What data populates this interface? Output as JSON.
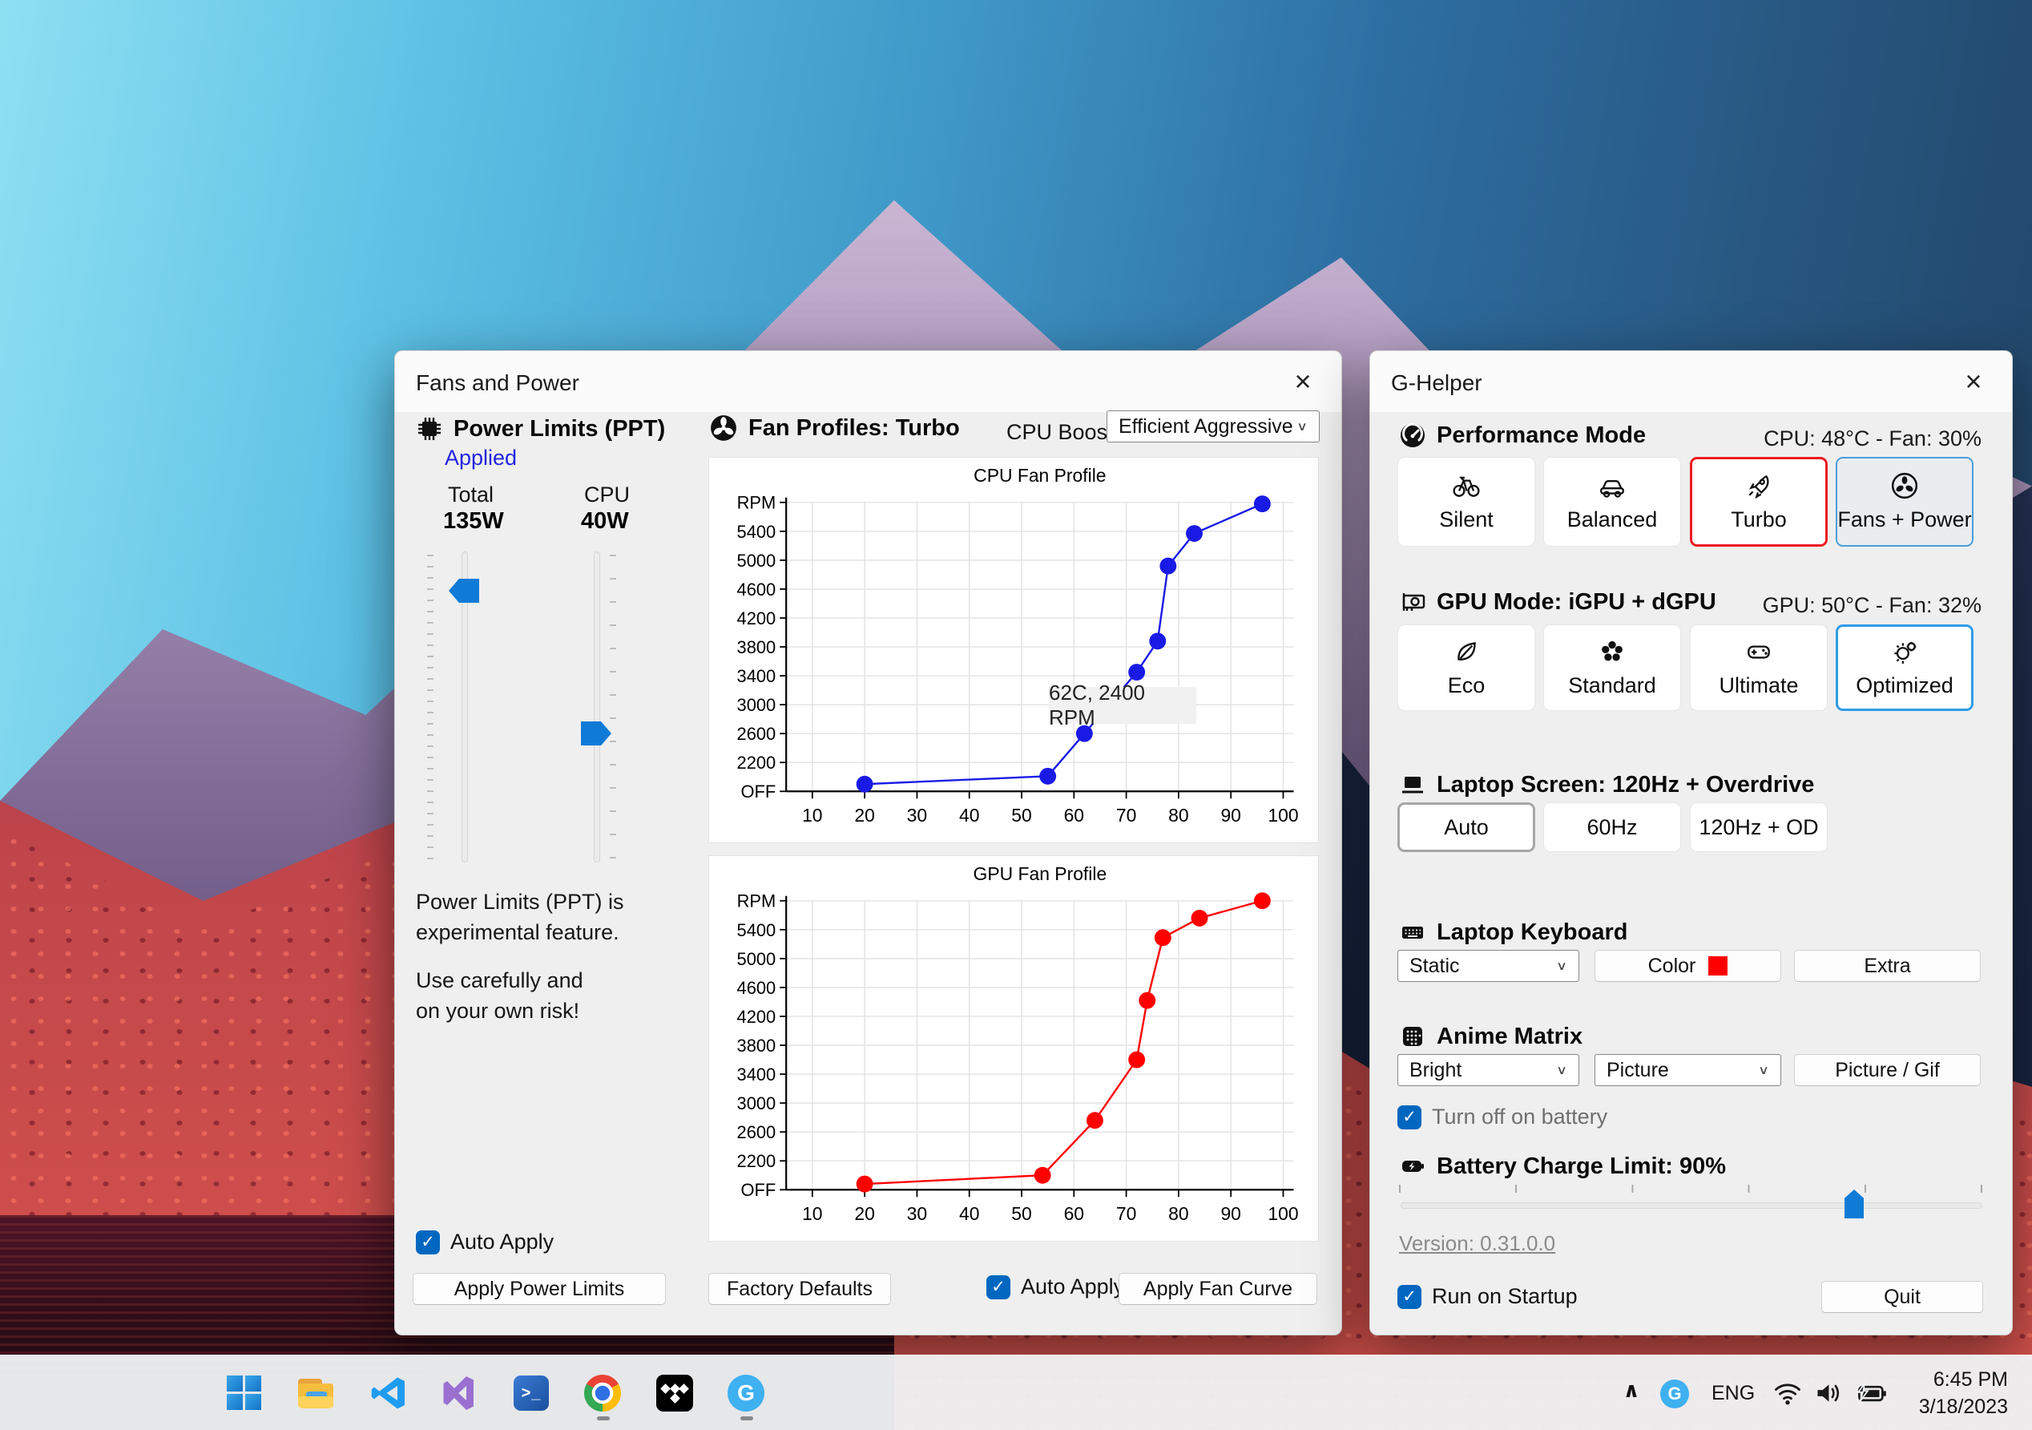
{
  "icons": {
    "close": "×",
    "chevron_down": "∨",
    "chevron_up": "∧",
    "check": "✓",
    "prompt": ">_",
    "g_logo": "G"
  },
  "colors": {
    "accent_blue": "#0f7bd7",
    "checkbox_blue": "#0067c0",
    "turbo_selected_border": "#ed1b24",
    "optimized_selected_border": "#2f9ce8",
    "cpu_series": "#1a1ae6",
    "gpu_series": "#ff0000",
    "keyboard_color_swatch": "#ff0000",
    "applied_text": "#2323e0"
  },
  "fans_window": {
    "title": "Fans and Power",
    "power_limits": {
      "header": "Power Limits (PPT)",
      "status": "Applied",
      "total_label": "Total",
      "total_value": "135W",
      "cpu_label": "CPU",
      "cpu_value": "40W",
      "warning1": "Power Limits (PPT) is",
      "warning2": "experimental feature.",
      "warning3": "Use carefully and",
      "warning4": "on your own risk!",
      "auto_apply": "Auto Apply",
      "apply_button": "Apply Power Limits"
    },
    "fan_profiles": {
      "header": "Fan Profiles: Turbo",
      "cpu_boost_label": "CPU Boost",
      "cpu_boost_value": "Efficient Aggressive",
      "factory_defaults": "Factory Defaults",
      "auto_apply": "Auto Apply",
      "apply_button": "Apply Fan Curve"
    }
  },
  "chart_data": [
    {
      "type": "line",
      "title": "CPU Fan Profile",
      "xlabel": "",
      "ylabel": "RPM",
      "x_ticks": [
        10,
        20,
        30,
        40,
        50,
        60,
        70,
        80,
        90,
        100
      ],
      "y_ticks": [
        "OFF",
        2200,
        2600,
        3000,
        3400,
        3800,
        4200,
        4600,
        5000,
        5400
      ],
      "y_top_label": "RPM",
      "xlim": [
        5,
        102
      ],
      "ylim": [
        1800,
        5800
      ],
      "grid": true,
      "legend": false,
      "series": [
        {
          "name": "CPU fan curve",
          "color": "#1a1ae6",
          "points": [
            [
              20,
              1900
            ],
            [
              55,
              2010
            ],
            [
              62,
              2600
            ],
            [
              72,
              3450
            ],
            [
              76,
              3880
            ],
            [
              78,
              4920
            ],
            [
              83,
              5370
            ],
            [
              96,
              5780
            ]
          ]
        }
      ],
      "annotation": {
        "text": "62C, 2400 RPM"
      }
    },
    {
      "type": "line",
      "title": "GPU Fan Profile",
      "xlabel": "",
      "ylabel": "RPM",
      "x_ticks": [
        10,
        20,
        30,
        40,
        50,
        60,
        70,
        80,
        90,
        100
      ],
      "y_ticks": [
        "OFF",
        2200,
        2600,
        3000,
        3400,
        3800,
        4200,
        4600,
        5000,
        5400
      ],
      "y_top_label": "RPM",
      "xlim": [
        5,
        102
      ],
      "ylim": [
        1800,
        5800
      ],
      "grid": true,
      "legend": false,
      "series": [
        {
          "name": "GPU fan curve",
          "color": "#ff0000",
          "points": [
            [
              20,
              1880
            ],
            [
              54,
              2000
            ],
            [
              64,
              2760
            ],
            [
              72,
              3600
            ],
            [
              74,
              4420
            ],
            [
              77,
              5290
            ],
            [
              84,
              5560
            ],
            [
              96,
              5800
            ]
          ]
        }
      ]
    }
  ],
  "ghelper_window": {
    "title": "G-Helper",
    "performance": {
      "header": "Performance Mode",
      "status": "CPU: 48°C -  Fan: 30%",
      "buttons": [
        {
          "label": "Silent",
          "icon": "bicycle-icon",
          "selected": false
        },
        {
          "label": "Balanced",
          "icon": "car-icon",
          "selected": false
        },
        {
          "label": "Turbo",
          "icon": "rocket-icon",
          "selected": true
        },
        {
          "label": "Fans + Power",
          "icon": "fan-icon",
          "selected": false,
          "window_open": true
        }
      ]
    },
    "gpu": {
      "header": "GPU Mode: iGPU + dGPU",
      "status": "GPU: 50°C -  Fan: 32%",
      "buttons": [
        {
          "label": "Eco",
          "icon": "leaf-icon",
          "selected": false
        },
        {
          "label": "Standard",
          "icon": "flower-icon",
          "selected": false
        },
        {
          "label": "Ultimate",
          "icon": "gamepad-icon",
          "selected": false
        },
        {
          "label": "Optimized",
          "icon": "bulb-gear-icon",
          "selected": true
        }
      ]
    },
    "screen": {
      "header": "Laptop Screen: 120Hz + Overdrive",
      "buttons": [
        {
          "label": "Auto",
          "selected": true
        },
        {
          "label": "60Hz",
          "selected": false
        },
        {
          "label": "120Hz + OD",
          "selected": false
        }
      ]
    },
    "keyboard": {
      "header": "Laptop Keyboard",
      "mode_value": "Static",
      "color_button": "Color",
      "color_value": "#ff0000",
      "extra_button": "Extra"
    },
    "anime": {
      "header": "Anime Matrix",
      "brightness_value": "Bright",
      "mode_value": "Picture",
      "picture_button": "Picture / Gif",
      "battery_checkbox": "Turn off on battery"
    },
    "battery": {
      "header": "Battery Charge Limit: 90%",
      "value": 90
    },
    "version_link": "Version: 0.31.0.0",
    "run_on_startup": "Run on Startup",
    "quit_button": "Quit"
  },
  "taskbar": {
    "icons": [
      {
        "name": "start"
      },
      {
        "name": "file-explorer"
      },
      {
        "name": "vscode"
      },
      {
        "name": "visual-studio"
      },
      {
        "name": "powershell"
      },
      {
        "name": "chrome",
        "running": true
      },
      {
        "name": "tidal"
      },
      {
        "name": "g-helper",
        "running": true
      }
    ],
    "tray": {
      "language": "ENG",
      "time": "6:45 PM",
      "date": "3/18/2023"
    }
  }
}
